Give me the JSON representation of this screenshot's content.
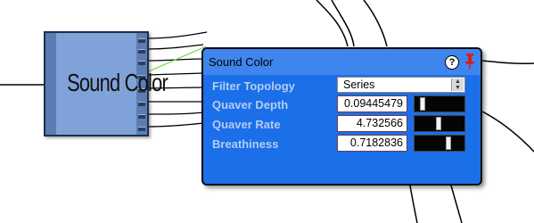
{
  "node": {
    "title": "Sound Color"
  },
  "panel": {
    "title": "Sound Color",
    "help_symbol": "?",
    "header_icons": [
      "help-icon",
      "pin-icon"
    ],
    "colors": {
      "panel_bg": "#1b6fe8",
      "header_bg": "#3f85ee",
      "label": "#b4ccf7",
      "node_bg": "#7fa3d8"
    },
    "filter_topology": {
      "label": "Filter Topology",
      "value": "Series"
    },
    "quaver_depth": {
      "label": "Quaver Depth",
      "value": "0.09445479",
      "slider_level": 0.09445479
    },
    "quaver_rate": {
      "label": "Quaver Rate",
      "value": "4.732566",
      "slider_level": 0.47
    },
    "breathiness": {
      "label": "Breathiness",
      "value": "0.7182836",
      "slider_level": 0.7182836
    }
  }
}
